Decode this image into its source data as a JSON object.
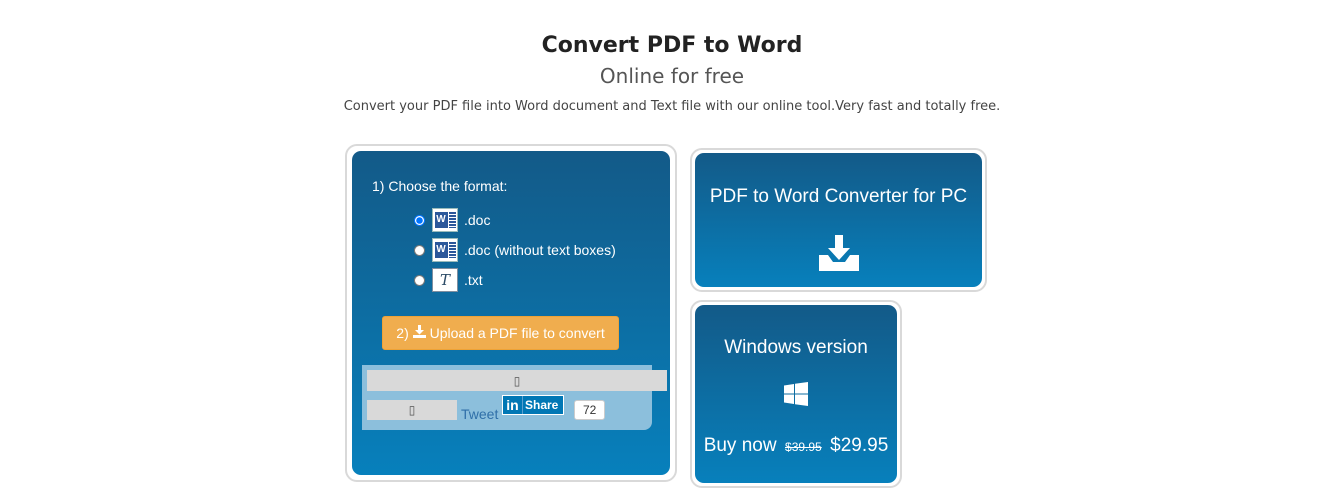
{
  "header": {
    "title": "Convert PDF to Word",
    "subtitle": "Online for free",
    "description": "Convert your PDF file into Word document and Text file with our online tool.Very fast and totally free."
  },
  "converter": {
    "step1_label": "1) Choose the format:",
    "formats": [
      {
        "label": ".doc",
        "icon": "word-icon",
        "selected": true
      },
      {
        "label": ".doc (without text boxes)",
        "icon": "word-icon",
        "selected": false
      },
      {
        "label": ".txt",
        "icon": "text-file-icon",
        "selected": false
      }
    ],
    "upload_step": "2)",
    "upload_label": "Upload a PDF file to convert",
    "upload_icon": "download-icon"
  },
  "social": {
    "tweet_label": "Tweet",
    "linkedin_label": "Share",
    "linkedin_logo": "in",
    "linkedin_count": "72",
    "placeholder_icon": "broken-image-icon"
  },
  "pc_converter": {
    "title": "PDF to Word Converter for PC",
    "icon": "download-tray-icon"
  },
  "windows": {
    "title": "Windows version",
    "icon": "windows-logo-icon",
    "buy_label": "Buy now",
    "old_price": "$39.95",
    "new_price": "$29.95"
  },
  "colors": {
    "panel_top": "#135a88",
    "panel_bottom": "#0780bc",
    "upload_button": "#f0ad4e",
    "linkedin": "#0077b5"
  }
}
